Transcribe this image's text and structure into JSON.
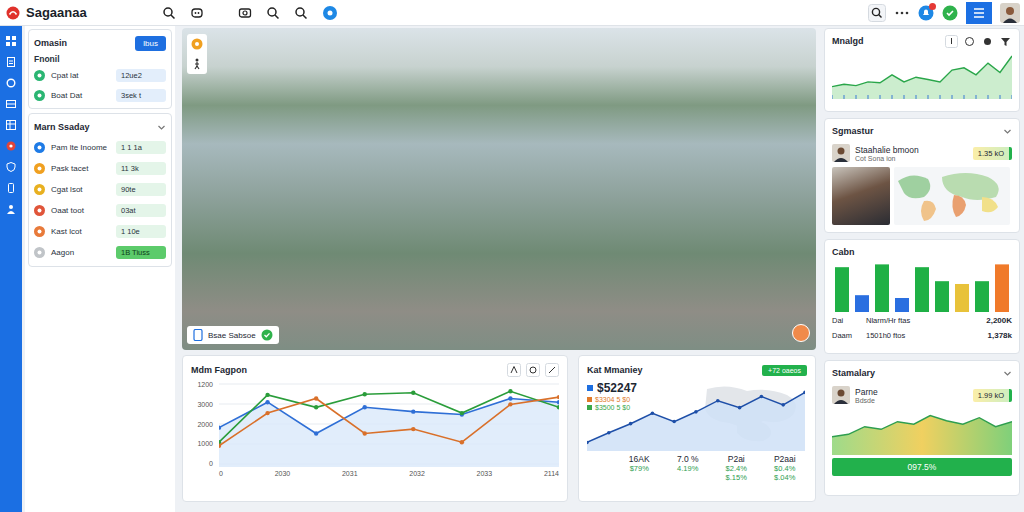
{
  "app": {
    "title": "Sagaanaa"
  },
  "left_panel": {
    "overview": {
      "title": "Omasin",
      "button": "lbus",
      "subtitle": "Fnonil",
      "rows": [
        {
          "label": "Cpat lat",
          "value": "12ue2",
          "color": "#2bb673"
        },
        {
          "label": "Boat Dat",
          "value": "3sek t",
          "color": "#2bb673"
        }
      ]
    },
    "summary": {
      "title": "Marn Ssaday",
      "expanded": true,
      "rows": [
        {
          "label": "Pam lte Inoome",
          "value": "1 1 1a",
          "color": "#1e7be6",
          "highlight": false
        },
        {
          "label": "Pask tacet",
          "value": "11 3k",
          "color": "#f0a020",
          "highlight": false
        },
        {
          "label": "Cgat lsot",
          "value": "90te",
          "color": "#e8b020",
          "highlight": false
        },
        {
          "label": "Oaat toot",
          "value": "03at",
          "color": "#e0553a",
          "highlight": false
        },
        {
          "label": "Kast lcot",
          "value": "1 10e",
          "color": "#e87a3a",
          "highlight": false
        },
        {
          "label": "Aagon",
          "value": "1B Tiuss",
          "color": "#c0c4c8",
          "highlight": true
        }
      ]
    }
  },
  "map": {
    "badge": "Bsae Sabsoe"
  },
  "line_chart": {
    "title": "Mdm Fagpon",
    "y_ticks": [
      "1200",
      "3000",
      "2000",
      "1000",
      "0"
    ],
    "x_ticks": [
      "0",
      "2030",
      "2031",
      "2032",
      "2033",
      "2114"
    ],
    "series": [
      {
        "color": "#2f6fd6",
        "values": [
          500,
          850,
          420,
          780,
          720,
          680,
          900,
          850
        ]
      },
      {
        "color": "#2a9d3a",
        "values": [
          300,
          950,
          780,
          960,
          980,
          700,
          1000,
          780
        ]
      },
      {
        "color": "#d9702a",
        "values": [
          250,
          700,
          900,
          420,
          480,
          300,
          820,
          920
        ]
      }
    ]
  },
  "money_card": {
    "title": "Kat Mmaniey",
    "badge": "+72 oaeos",
    "amount": "$52247",
    "amount_color": "#1e6fe0",
    "legend": [
      {
        "label": "$3304 5 $0",
        "color": "#e07a2a"
      },
      {
        "label": "$3500 5 $0",
        "color": "#3aa84a"
      }
    ],
    "trend": [
      8,
      22,
      35,
      50,
      38,
      52,
      68,
      58,
      74,
      62,
      80
    ],
    "stats": [
      {
        "lines": [
          "16AK",
          "$79%"
        ]
      },
      {
        "lines": [
          "7.0 %",
          "4.19%"
        ]
      },
      {
        "lines": [
          "P2ai",
          "$2.4%",
          "$.15%"
        ]
      },
      {
        "lines": [
          "P2aai",
          "$0.4%",
          "$.04%"
        ]
      }
    ]
  },
  "trend_card": {
    "title": "Mnalgd",
    "values": [
      20,
      25,
      22,
      30,
      28,
      45,
      30,
      40,
      35,
      30,
      55,
      60,
      45,
      70,
      50,
      85
    ]
  },
  "people_card": {
    "title": "Sgmastur",
    "expanded": true,
    "name": "Staahalie bmoon",
    "sub": "Cot Sona ion",
    "badge": "1.35 kO"
  },
  "bar_card": {
    "title": "Cabn",
    "bars": [
      {
        "value": 80,
        "color": "#1fb045"
      },
      {
        "value": 30,
        "color": "#2a6fe0"
      },
      {
        "value": 85,
        "color": "#1fb045"
      },
      {
        "value": 25,
        "color": "#2a6fe0"
      },
      {
        "value": 80,
        "color": "#1fb045"
      },
      {
        "value": 55,
        "color": "#1fb045"
      },
      {
        "value": 50,
        "color": "#e8c23a"
      },
      {
        "value": 55,
        "color": "#1fb045"
      },
      {
        "value": 85,
        "color": "#f07a2a"
      }
    ],
    "rows": [
      {
        "cells": [
          "Dai",
          "Nlarm/Hr ftas",
          "2,200K"
        ]
      },
      {
        "cells": [
          "Daam",
          "1501h0 ftos",
          "1,378k"
        ]
      }
    ]
  },
  "summary_card": {
    "title": "Stamalary",
    "expanded": true,
    "name": "Parne",
    "sub": "Bdsde",
    "badge": "1.99 kO",
    "values": [
      30,
      35,
      50,
      45,
      60,
      55,
      72,
      62,
      55,
      68,
      50,
      60
    ],
    "status": "097.5%"
  }
}
